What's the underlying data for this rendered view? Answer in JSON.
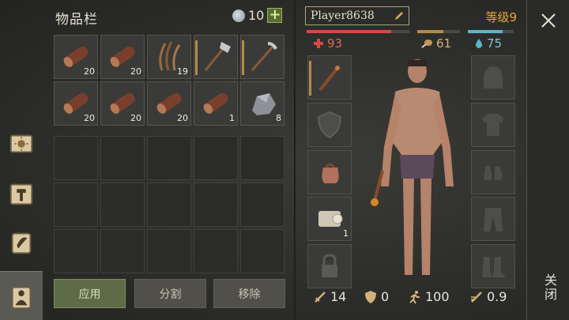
{
  "inventory": {
    "title": "物品栏",
    "currency": "10",
    "add_symbol": "+",
    "slots": [
      {
        "item": "log",
        "qty": "20"
      },
      {
        "item": "log",
        "qty": "20"
      },
      {
        "item": "fiber",
        "qty": "19"
      },
      {
        "item": "stone-axe",
        "qty": ""
      },
      {
        "item": "stone-pickaxe",
        "qty": ""
      },
      {
        "item": "log",
        "qty": "20"
      },
      {
        "item": "log",
        "qty": "20"
      },
      {
        "item": "log",
        "qty": "20"
      },
      {
        "item": "log",
        "qty": "1"
      },
      {
        "item": "stone",
        "qty": "8"
      }
    ],
    "buttons": {
      "apply": "应用",
      "split": "分割",
      "remove": "移除"
    }
  },
  "player": {
    "name": "Player8638",
    "level": "等级9",
    "health": "93",
    "food": "61",
    "water": "75",
    "bars": {
      "health": 0.82,
      "food": 0.62,
      "water": 0.75
    },
    "equipment": {
      "weapon": "torch",
      "shield": "shield-icon",
      "bag": "bag-icon",
      "scroll_qty": "1",
      "locked": "lock-icon"
    },
    "stats": {
      "attack": "14",
      "defense": "0",
      "speed": "100",
      "attack_speed": "0.9"
    }
  },
  "close": {
    "label": "关闭"
  },
  "colors": {
    "accent": "#e5a93a",
    "health": "#d6484a",
    "food": "#b78a45",
    "water": "#5fb3c6"
  }
}
